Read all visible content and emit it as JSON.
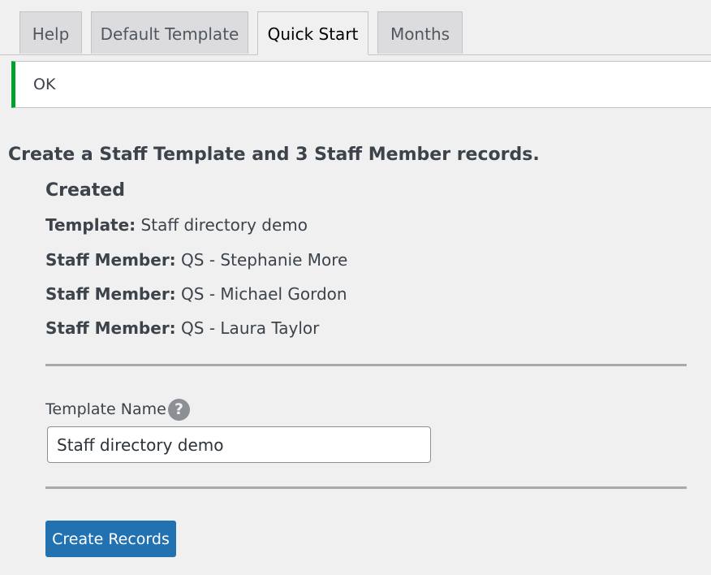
{
  "tabs": [
    {
      "label": "Help",
      "active": false
    },
    {
      "label": "Default Template",
      "active": false
    },
    {
      "label": "Quick Start",
      "active": true
    },
    {
      "label": "Months",
      "active": false
    }
  ],
  "notice": {
    "text": "OK",
    "color": "#00a32a"
  },
  "intro": "Create a Staff Template and 3 Staff Member records.",
  "created": {
    "heading": "Created",
    "items": [
      {
        "label": "Template:",
        "value": "Staff directory demo"
      },
      {
        "label": "Staff Member:",
        "value": "QS - Stephanie More"
      },
      {
        "label": "Staff Member:",
        "value": "QS - Michael Gordon"
      },
      {
        "label": "Staff Member:",
        "value": "QS - Laura Taylor"
      }
    ]
  },
  "form": {
    "template_name_label": "Template Name",
    "help_icon": "question-mark-circle-icon",
    "help_glyph": "?",
    "template_name_value": "Staff directory demo",
    "submit_label": "Create Records"
  },
  "colors": {
    "accent": "#2271b1",
    "background": "#f0f0f1",
    "success": "#00a32a"
  }
}
